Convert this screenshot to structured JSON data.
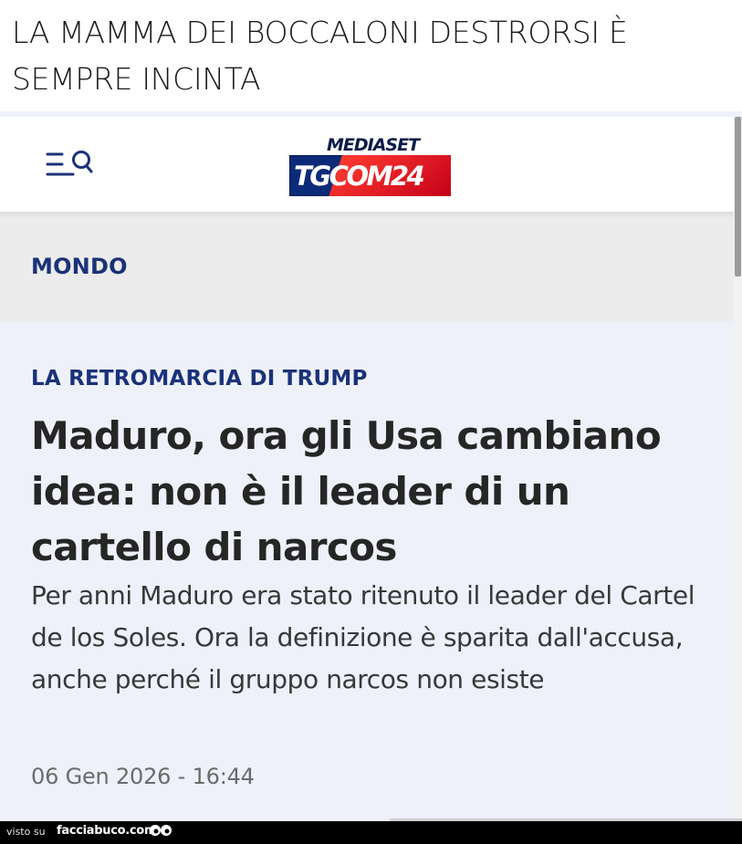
{
  "caption": {
    "text": "LA MAMMA DEI BOCCALONI DESTRORSI È SEMPRE INCINTA"
  },
  "app": {
    "logo_top": "MEDIASET",
    "logo_main": "TGCOM24",
    "menu_icon": "menu-search-icon"
  },
  "section": {
    "label": "MONDO"
  },
  "article": {
    "kicker": "LA RETROMARCIA DI TRUMP",
    "headline": "Maduro, ora gli Usa cambiano idea: non è il leader di un cartello di narcos",
    "summary": "Per anni Maduro era stato ritenuto il leader del Cartel de los Soles. Ora la definizione è sparita dall'accusa, anche perché il gruppo narcos non esiste",
    "timestamp": "06 Gen 2026 - 16:44"
  },
  "footer": {
    "prefix": "visto su",
    "brand": "facciabuco.com"
  },
  "colors": {
    "brand_navy": "#1a3279",
    "logo_blue": "#0b2a78",
    "logo_red": "#e8001c",
    "article_bg": "#eef1fa"
  }
}
